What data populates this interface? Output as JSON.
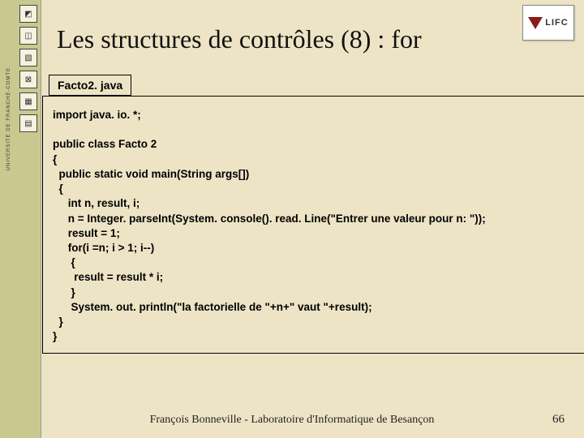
{
  "sidebar": {
    "label": "UNIVERSITÉ DE FRANCHE-COMTÉ",
    "icons": [
      "◩",
      "◫",
      "▧",
      "⊠",
      "▦",
      "▤"
    ]
  },
  "logo": {
    "text": "LIFC"
  },
  "title": "Les structures de contrôles (8) : for",
  "filename": "Facto2. java",
  "code_lines": [
    "import java. io. *;",
    "",
    "public class Facto 2",
    "{",
    "  public static void main(String args[])",
    "  {",
    "     int n, result, i;",
    "     n = Integer. parseInt(System. console(). read. Line(\"Entrer une valeur pour n: \"));",
    "     result = 1;",
    "     for(i =n; i > 1; i--)",
    "      {",
    "       result = result * i;",
    "      }",
    "      System. out. println(\"la factorielle de \"+n+\" vaut \"+result);",
    "  }",
    "}"
  ],
  "footer": "François Bonneville - Laboratoire d'Informatique de Besançon",
  "page": "66"
}
